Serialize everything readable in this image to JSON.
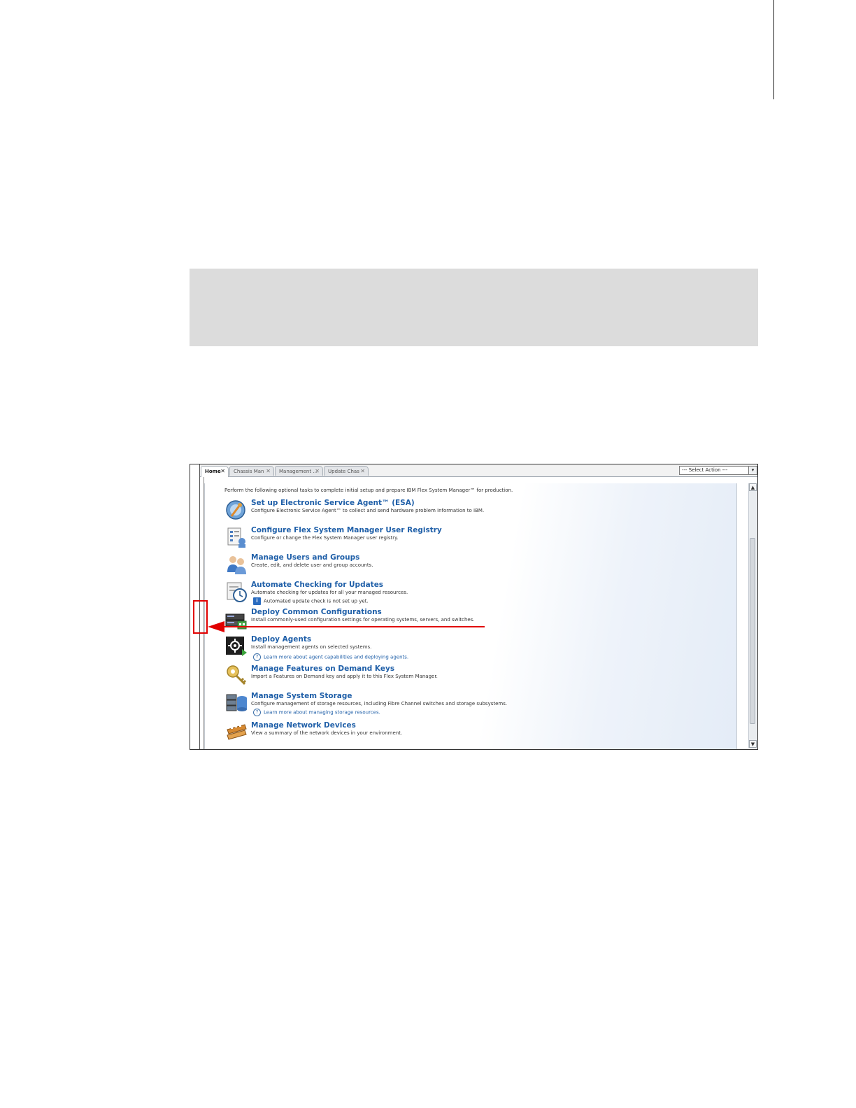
{
  "tabs": [
    {
      "label": "Home",
      "active": true
    },
    {
      "label": "Chassis Man",
      "active": false
    },
    {
      "label": "Management ...",
      "active": false
    },
    {
      "label": "Update Chas",
      "active": false
    }
  ],
  "action_select": {
    "value": "--- Select Action ---"
  },
  "intro": "Perform the following optional tasks to complete initial setup and prepare IBM Flex System Manager™ for production.",
  "tasks": [
    {
      "title": "Set up Electronic Service Agent™ (ESA)",
      "desc": "Configure Electronic Service Agent™ to collect and send hardware problem information to IBM.",
      "icon": "globe-wrench-icon"
    },
    {
      "title": "Configure Flex System Manager User Registry",
      "desc": "Configure or change the Flex System Manager user registry.",
      "icon": "registry-icon"
    },
    {
      "title": "Manage Users and Groups",
      "desc": "Create, edit, and delete user and group accounts.",
      "icon": "users-icon"
    },
    {
      "title": "Automate Checking for Updates",
      "desc": "Automate checking for updates for all your managed resources.",
      "sub": "Automated update check is not set up yet.",
      "icon": "clock-check-icon"
    },
    {
      "title": "Deploy Common Configurations",
      "desc": "Install commonly-used configuration settings for operating systems, servers, and switches.",
      "icon": "server-config-icon"
    },
    {
      "title": "Deploy Agents",
      "desc": "Install management agents on selected systems.",
      "sub": "Learn more about agent capabilities and deploying agents.",
      "icon": "agent-icon"
    },
    {
      "title": "Manage Features on Demand Keys",
      "desc": "Import a Features on Demand key and apply it to this Flex System Manager.",
      "icon": "key-icon"
    },
    {
      "title": "Manage System Storage",
      "desc": "Configure management of storage resources, including Fibre Channel switches and storage subsystems.",
      "sub": "Learn more about managing storage resources.",
      "icon": "storage-icon"
    },
    {
      "title": "Manage Network Devices",
      "desc": "View a summary of the network devices in your environment.",
      "icon": "network-device-icon"
    }
  ]
}
